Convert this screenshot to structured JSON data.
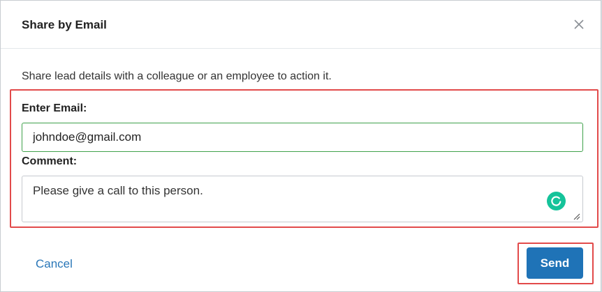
{
  "dialog": {
    "title": "Share by Email",
    "description": "Share lead details with a colleague or an employee to action it."
  },
  "form": {
    "email_label": "Enter Email:",
    "email_value": "johndoe@gmail.com",
    "comment_label": "Comment:",
    "comment_value": "Please give a call to this person."
  },
  "footer": {
    "cancel_label": "Cancel",
    "send_label": "Send"
  },
  "icons": {
    "close": "close-icon",
    "grammarly": "grammarly-icon",
    "resize": "resize-grip-icon"
  },
  "colors": {
    "primary": "#1f73b7",
    "link": "#2a77b8",
    "highlight": "#e24a4a",
    "valid_border": "#3fa14b",
    "grammarly": "#15c39a"
  }
}
